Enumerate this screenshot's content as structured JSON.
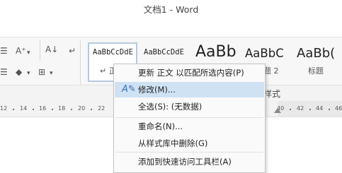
{
  "window": {
    "title": "文档1 - Word"
  },
  "ribbon": {
    "styles_gallery": [
      {
        "sample": "AaBbCcDdE",
        "caption": "↵ 正文"
      },
      {
        "sample": "AaBbCcDdE",
        "caption": ""
      },
      {
        "sample": "AaBb",
        "caption": ""
      },
      {
        "sample": "AaBbC",
        "caption": "题 2"
      },
      {
        "sample": "AaBb(",
        "caption": "标题"
      }
    ],
    "group_label_suffix": "样式"
  },
  "ruler": {
    "ticks": [
      "12",
      "14",
      "16",
      "18",
      "20",
      "22",
      "40",
      "42",
      "44",
      "46"
    ]
  },
  "context_menu": {
    "items": [
      {
        "label": "更新 正文 以匹配所选内容(P)"
      },
      {
        "label": "修改(M)...",
        "icon": "edit-style-icon",
        "highlighted": true
      },
      {
        "label": "全选(S): (无数据)"
      },
      {
        "label": "重命名(N)..."
      },
      {
        "label": "从样式库中删除(G)"
      },
      {
        "label": "添加到快速访问工具栏(A)"
      }
    ]
  }
}
